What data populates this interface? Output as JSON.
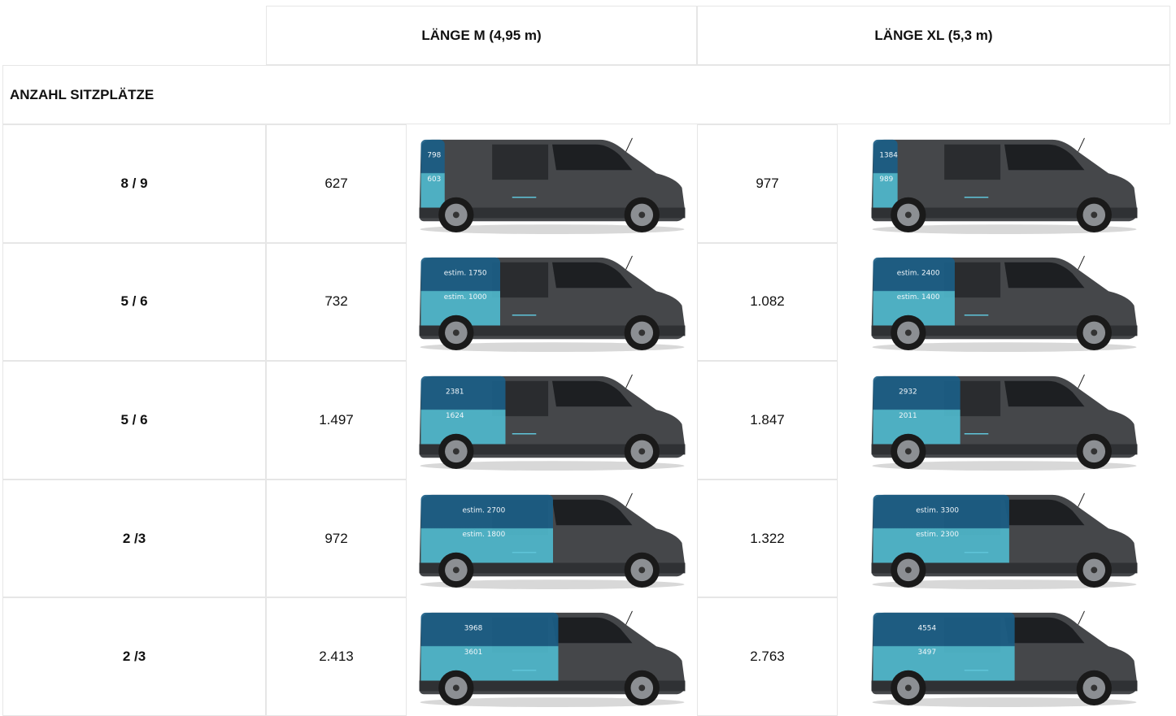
{
  "columns": {
    "m_label": "LÄNGE M (4,95 m)",
    "xl_label": "LÄNGE XL (5,3 m)"
  },
  "section_label": "ANZAHL SITZPLÄTZE",
  "colors": {
    "cargo_top": "#1b5e86",
    "cargo_bottom": "#4fb8cc",
    "body": "#45474a",
    "border": "#e6e6e6"
  },
  "rows": [
    {
      "seats": "8 / 9",
      "m_value": "627",
      "xl_value": "977",
      "m_img": {
        "top": "798",
        "bottom": "603"
      },
      "xl_img": {
        "top": "1384",
        "bottom": "989"
      },
      "cargo_extent": 0.09
    },
    {
      "seats": "5 / 6",
      "m_value": "732",
      "xl_value": "1.082",
      "m_img": {
        "top": "estim. 1750",
        "bottom": "estim. 1000"
      },
      "xl_img": {
        "top": "estim. 2400",
        "bottom": "estim. 1400"
      },
      "cargo_extent": 0.3
    },
    {
      "seats": "5 / 6",
      "m_value": "1.497",
      "xl_value": "1.847",
      "m_img": {
        "top": "2381",
        "bottom": "1624"
      },
      "xl_img": {
        "top": "2932",
        "bottom": "2011"
      },
      "cargo_extent": 0.32
    },
    {
      "seats": "2 /3",
      "m_value": "972",
      "xl_value": "1.322",
      "m_img": {
        "top": "estim. 2700",
        "bottom": "estim. 1800"
      },
      "xl_img": {
        "top": "estim. 3300",
        "bottom": "estim. 2300"
      },
      "cargo_extent": 0.5
    },
    {
      "seats": "2 /3",
      "m_value": "2.413",
      "xl_value": "2.763",
      "m_img": {
        "top": "3968",
        "bottom": "3601"
      },
      "xl_img": {
        "top": "4554",
        "bottom": "3497"
      },
      "cargo_extent": 0.52
    }
  ]
}
